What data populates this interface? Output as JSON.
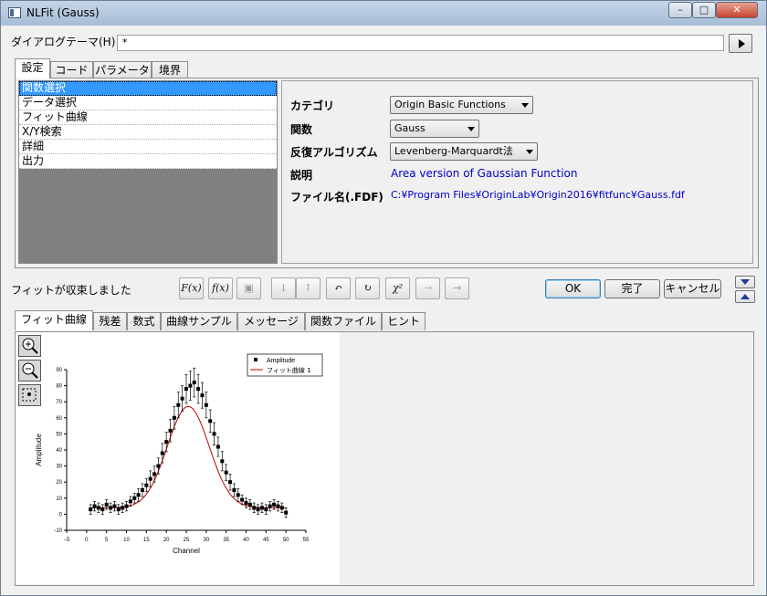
{
  "window": {
    "title": "NLFit (Gauss)"
  },
  "dialog_theme": {
    "label": "ダイアログテーマ(H)",
    "value": "*"
  },
  "top_tabs": [
    "設定",
    "コード",
    "パラメータ",
    "境界"
  ],
  "settings_list": [
    "関数選択",
    "データ選択",
    "フィット曲線",
    "X/Y検索",
    "詳細",
    "出力"
  ],
  "function_panel": {
    "category_label": "カテゴリ",
    "category_value": "Origin Basic Functions",
    "function_label": "関数",
    "function_value": "Gauss",
    "algorithm_label": "反復アルゴリズム",
    "algorithm_value": "Levenberg-Marquardt法",
    "description_label": "説明",
    "description_value": "Area version of Gaussian Function",
    "file_label": "ファイル名(.FDF)",
    "file_value": "C:¥Program Files¥OriginLab¥Origin2016¥fitfunc¥Gauss.fdf"
  },
  "status_text": "フィットが収束しました",
  "toolbar_icons": [
    "init-icon",
    "fix-icon",
    "save-icon",
    "sort-down-icon",
    "sort-up-icon",
    "one-iteration-icon",
    "iterate-icon",
    "chi-square-icon",
    "step-icon",
    "fit-until-converged-icon"
  ],
  "toolbar_glyphs": [
    "F(x)",
    "f(x)",
    "▣",
    "↓",
    "↑",
    "↶",
    "↻",
    "χ²",
    "⇢",
    "⇥"
  ],
  "buttons": {
    "ok": "OK",
    "done": "完了",
    "cancel": "キャンセル"
  },
  "bottom_tabs": [
    "フィット曲線",
    "残差",
    "数式",
    "曲線サンプル",
    "メッセージ",
    "関数ファイル",
    "ヒント"
  ],
  "zoom_icons": [
    "zoom-in-icon",
    "zoom-out-icon",
    "zoom-fit-icon"
  ],
  "chart_data": {
    "type": "scatter",
    "xlabel": "Channel",
    "ylabel": "Amplitude",
    "xlim": [
      -5,
      35
    ],
    "ylim": [
      -10,
      90
    ],
    "xticks": [
      -5,
      0,
      5,
      10,
      15,
      20,
      25,
      30,
      35,
      40,
      45,
      50,
      55
    ],
    "yticks": [
      -10,
      0,
      10,
      20,
      30,
      40,
      50,
      60,
      70,
      80,
      90
    ],
    "xtick_labels": [
      "−5",
      "0",
      "5",
      "10",
      "15",
      "20",
      "25",
      "30",
      "35",
      "40",
      "45",
      "50",
      "55"
    ],
    "legend": [
      "Amplitude",
      "フィット曲線 1"
    ],
    "legend_position": "top-right",
    "colors": {
      "data": "#000000",
      "fit": "#c00000"
    },
    "series": [
      {
        "name": "Amplitude",
        "x": [
          1,
          2,
          3,
          4,
          5,
          6,
          7,
          8,
          9,
          10,
          11,
          12,
          13,
          14,
          15,
          16,
          17,
          18,
          19,
          20,
          21,
          22,
          23,
          24,
          25,
          26,
          27,
          28,
          29,
          30,
          31,
          32,
          33,
          34,
          35,
          36,
          37,
          38,
          39,
          40,
          41,
          42,
          43,
          44,
          45,
          46,
          47,
          48,
          49,
          50
        ],
        "y": [
          3,
          5,
          4,
          3,
          6,
          4,
          5,
          3,
          4,
          5,
          8,
          10,
          12,
          15,
          18,
          22,
          25,
          30,
          38,
          45,
          52,
          60,
          68,
          72,
          78,
          80,
          82,
          78,
          74,
          68,
          58,
          50,
          42,
          33,
          26,
          20,
          15,
          12,
          9,
          7,
          6,
          4,
          3,
          4,
          3,
          5,
          6,
          5,
          4,
          1
        ],
        "err": [
          3,
          3,
          3,
          3,
          3,
          3,
          3,
          3,
          3,
          3,
          3,
          3,
          4,
          4,
          4,
          5,
          5,
          5,
          6,
          6,
          7,
          7,
          8,
          8,
          9,
          9,
          9,
          9,
          8,
          8,
          7,
          7,
          6,
          6,
          5,
          5,
          4,
          4,
          3,
          3,
          3,
          3,
          3,
          3,
          3,
          3,
          3,
          3,
          3,
          3
        ]
      },
      {
        "name": "フィット曲線 1",
        "model": "gauss",
        "y0": 4,
        "xc": 25.5,
        "w": 10.5,
        "A": 830
      }
    ]
  }
}
